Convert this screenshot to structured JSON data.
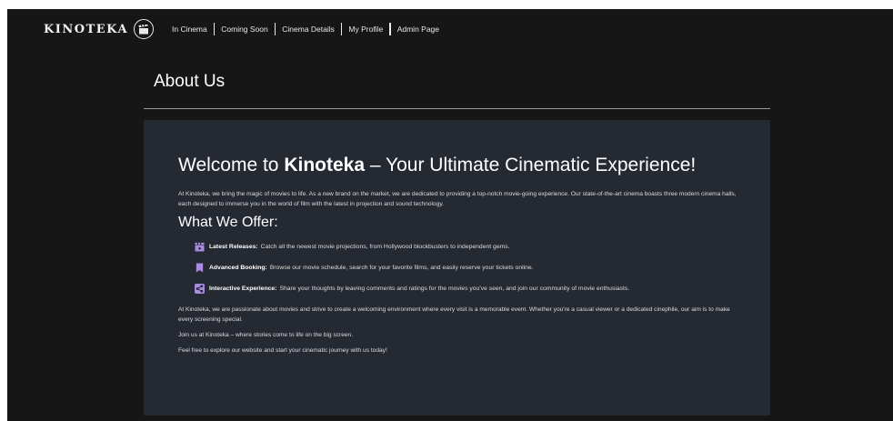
{
  "brand": {
    "name": "KINOTEKA",
    "logo_icon": "film-clapperboard-icon"
  },
  "nav": {
    "items": [
      "In Cinema",
      "Coming Soon",
      "Cinema Details",
      "My Profile",
      "Admin Page"
    ]
  },
  "page": {
    "title": "About Us"
  },
  "content": {
    "welcome_prefix": "Welcome to",
    "welcome_brand": "Kinoteka",
    "welcome_suffix": "– Your Ultimate Cinematic Experience!",
    "intro": "At Kinoteka, we bring the magic of movies to life. As a new brand on the market, we are dedicated to providing a top-notch movie-going experience. Our state-of-the-art cinema boasts three modern cinema halls, each designed to immerse you in the world of film with the latest in projection and sound technology.",
    "offer_title": "What We Offer:",
    "offers": [
      {
        "icon": "clapperboard-icon",
        "title": "Latest Releases:",
        "text": "Catch all the newest movie projections, from Hollywood blockbusters to independent gems."
      },
      {
        "icon": "bookmark-icon",
        "title": "Advanced Booking:",
        "text": "Browse our movie schedule, search for your favorite films, and easily reserve your tickets online."
      },
      {
        "icon": "share-icon",
        "title": "Interactive Experience:",
        "text": "Share your thoughts by leaving comments and ratings for the movies you've seen, and join our community of movie enthusiasts."
      }
    ],
    "passion": "At Kinoteka, we are passionate about movies and strive to create a welcoming environment where every visit is a memorable event. Whether you're a casual viewer or a dedicated cinephile, our aim is to make every screening special.",
    "join": "Join us at Kinoteka – where stories come to life on the big screen.",
    "explore": "Feel free to explore our website and start your cinematic journey with us today!"
  },
  "colors": {
    "background": "#161616",
    "card": "#252932",
    "icon_accent": "#a78be0",
    "text": "#dcdcdc"
  }
}
